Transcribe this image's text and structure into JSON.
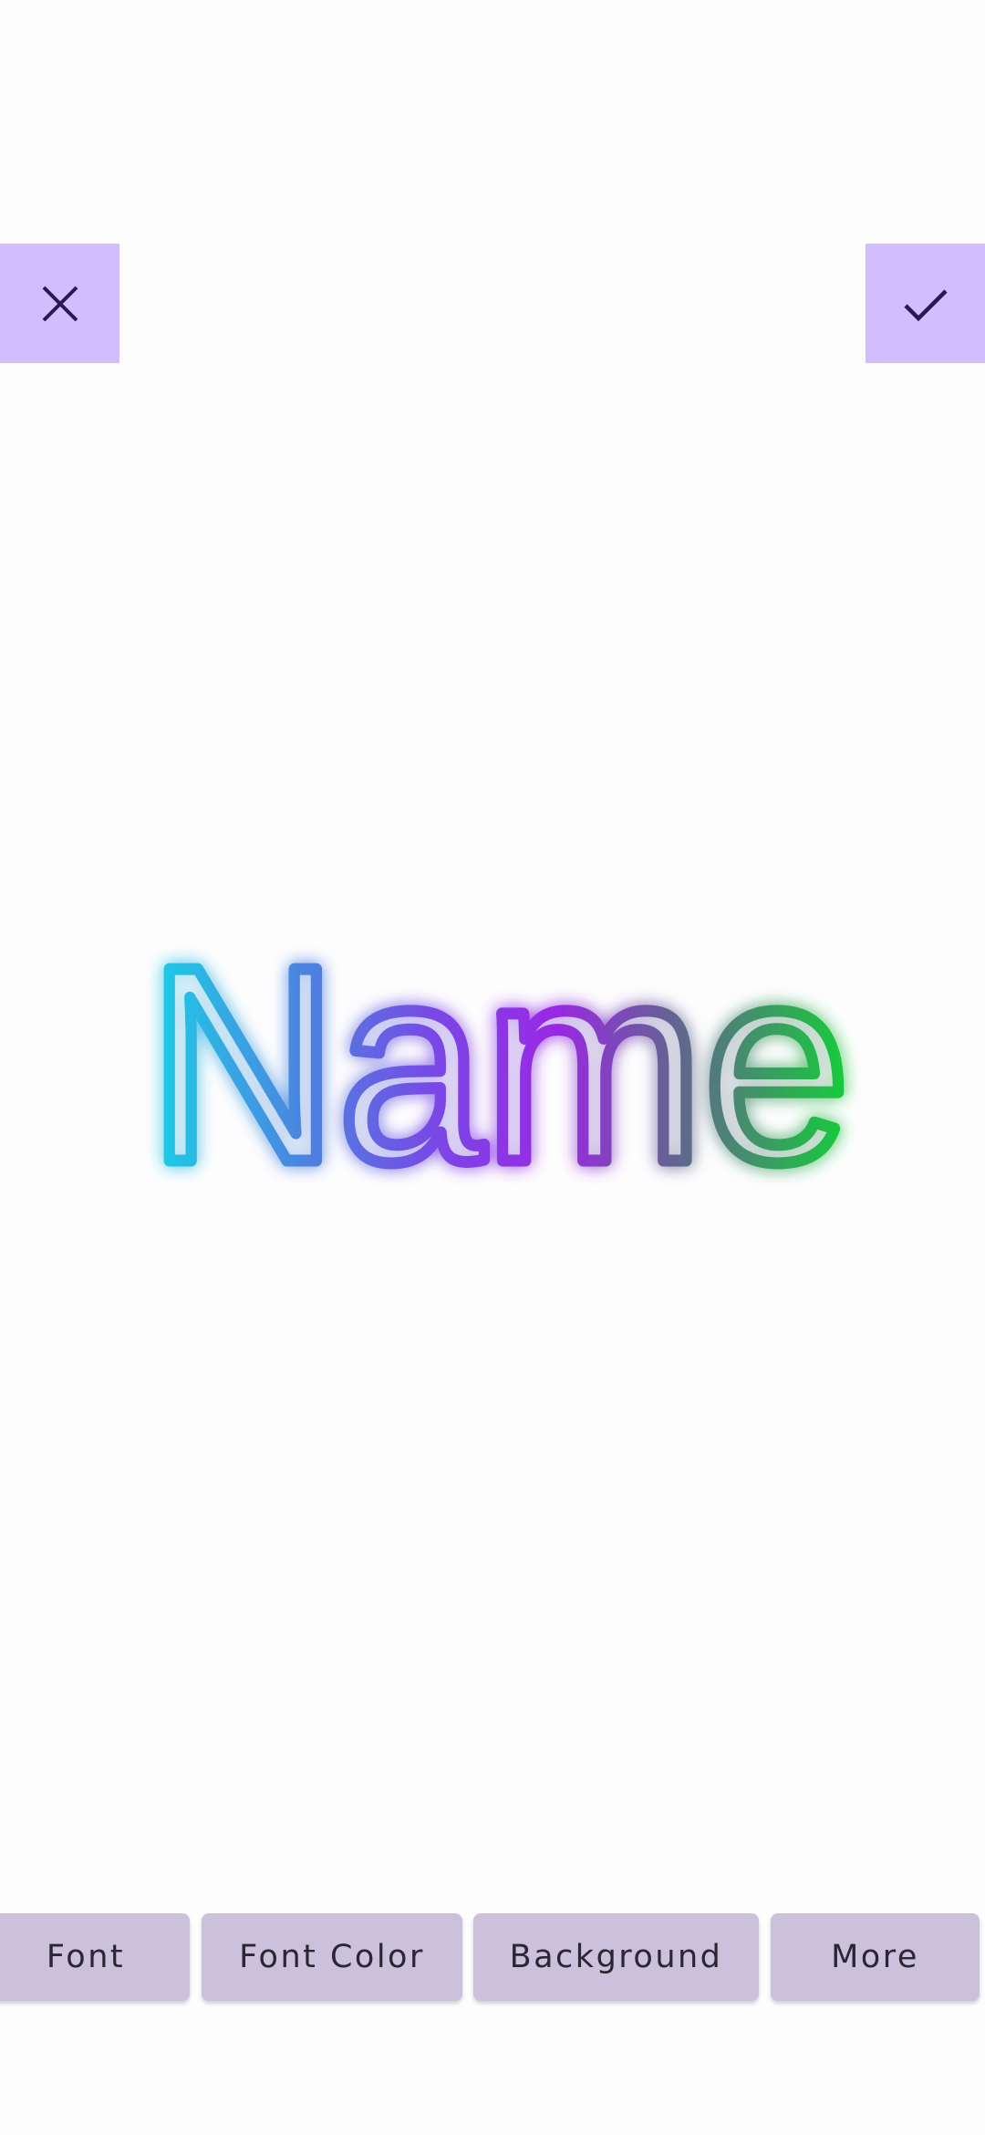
{
  "header": {
    "close_icon": "close-icon",
    "confirm_icon": "check-icon",
    "accent_color": "#d2befe",
    "icon_color": "#2b1656"
  },
  "preview": {
    "text": "Name",
    "style": "neon-outline",
    "gradient_colors": [
      "#19d3e6",
      "#4d7ce3",
      "#8a2de8",
      "#9c2fe6",
      "#5c6b86",
      "#1fcf3a"
    ]
  },
  "toolbar": {
    "font_label": "Font",
    "font_color_label": "Font Color",
    "background_label": "Background",
    "more_label": "More",
    "button_color": "#cbc1da"
  }
}
